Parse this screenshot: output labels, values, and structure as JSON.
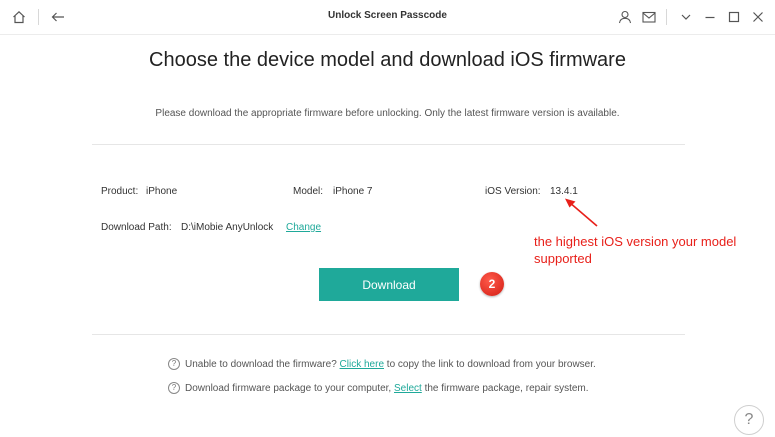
{
  "window": {
    "title": "Unlock Screen Passcode"
  },
  "main": {
    "heading": "Choose the device model and download iOS firmware",
    "subheading": "Please download the appropriate firmware before unlocking. Only the latest firmware version is available."
  },
  "device": {
    "product_label": "Product:",
    "product_value": "iPhone",
    "model_label": "Model:",
    "model_value": "iPhone 7",
    "ios_label": "iOS Version:",
    "ios_value": "13.4.1",
    "path_label": "Download Path:",
    "path_value": "D:\\iMobie AnyUnlock",
    "change_link": "Change"
  },
  "annotation": {
    "text": "the highest iOS version your model supported",
    "color": "#e8201a"
  },
  "actions": {
    "download_label": "Download",
    "step_number": "2"
  },
  "help": {
    "line1_prefix": "Unable to download the firmware?",
    "line1_link": "Click here",
    "line1_suffix": "to copy the link to download from your browser.",
    "line2_prefix": "Download firmware package to your computer,",
    "line2_link": "Select",
    "line2_suffix": "the firmware package, repair system.",
    "question_mark": "?",
    "help_button": "?"
  },
  "colors": {
    "accent": "#1fa99a",
    "badge": "#d21d14"
  },
  "icons": [
    "home-icon",
    "back-arrow-icon",
    "user-icon",
    "mail-icon",
    "chevron-down-icon",
    "minimize-icon",
    "maximize-icon",
    "close-icon",
    "help-icon"
  ]
}
